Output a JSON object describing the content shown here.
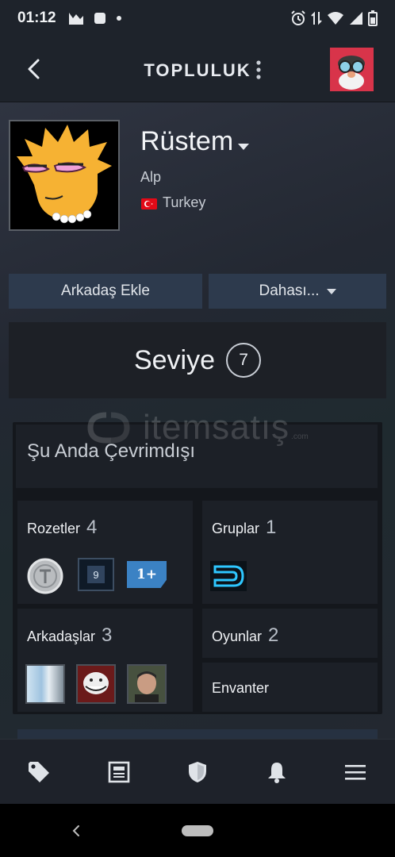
{
  "status_bar": {
    "time": "01:12",
    "left_icons": [
      "image-icon",
      "square-icon",
      "dot-icon"
    ],
    "right_icons": [
      "alarm-icon",
      "data-arrows-icon",
      "wifi-icon",
      "signal-icon",
      "battery-icon"
    ]
  },
  "header": {
    "title": "TOPLULUK"
  },
  "profile": {
    "name": "Rüstem",
    "real_name": "Alp",
    "country": "Turkey",
    "avatar": "lisa-simpson-avatar"
  },
  "buttons": {
    "add_friend": "Arkadaş Ekle",
    "more": "Dahası..."
  },
  "level": {
    "label": "Seviye",
    "value": "7"
  },
  "watermark": {
    "text": "itemsatış",
    "subtext": ".com"
  },
  "online_status": "Şu Anda Çevrimdışı",
  "cards": {
    "badges": {
      "label": "Rozetler",
      "count": "4",
      "items": [
        "silver-coin-badge",
        "nine-badge",
        "1+ badge"
      ],
      "badge_nine_text": "9",
      "badge_plus_text": "1+"
    },
    "groups": {
      "label": "Gruplar",
      "count": "1"
    },
    "friends": {
      "label": "Arkadaşlar",
      "count": "3"
    },
    "games": {
      "label": "Oyunlar",
      "count": "2"
    },
    "inventory": {
      "label": "Envanter"
    }
  },
  "bottom_nav": [
    "tag-icon",
    "news-icon",
    "shield-icon",
    "bell-icon",
    "menu-icon"
  ],
  "colors": {
    "accent_button": "#2d3a4d",
    "background": "#1b1f27",
    "card": "#1c2027",
    "flag_red": "#e30a17",
    "group_icon_cyan": "#2ec7ff"
  }
}
